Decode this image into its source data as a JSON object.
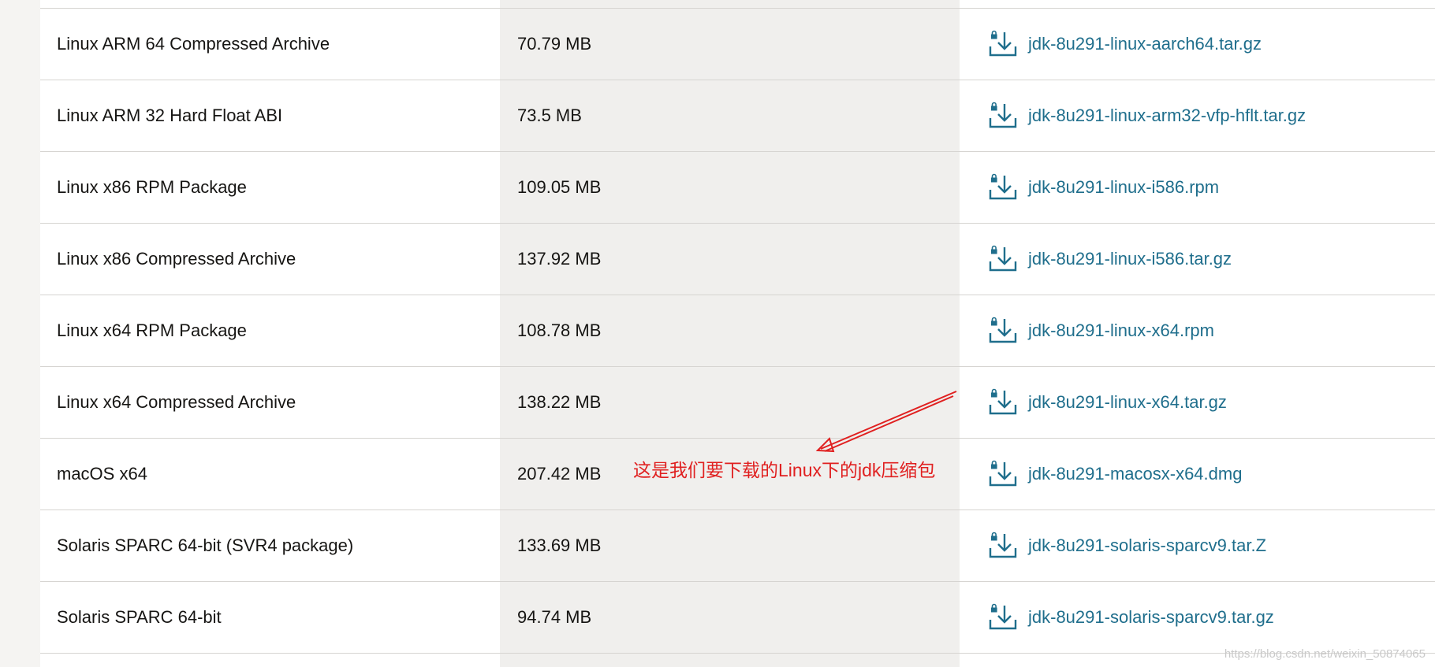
{
  "rows": [
    {
      "name": "Linux ARM 64 Compressed Archive",
      "size": "70.79 MB",
      "file": "jdk-8u291-linux-aarch64.tar.gz"
    },
    {
      "name": "Linux ARM 32 Hard Float ABI",
      "size": "73.5 MB",
      "file": "jdk-8u291-linux-arm32-vfp-hflt.tar.gz"
    },
    {
      "name": "Linux x86 RPM Package",
      "size": "109.05 MB",
      "file": "jdk-8u291-linux-i586.rpm"
    },
    {
      "name": "Linux x86 Compressed Archive",
      "size": "137.92 MB",
      "file": "jdk-8u291-linux-i586.tar.gz"
    },
    {
      "name": "Linux x64 RPM Package",
      "size": "108.78 MB",
      "file": "jdk-8u291-linux-x64.rpm"
    },
    {
      "name": "Linux x64 Compressed Archive",
      "size": "138.22 MB",
      "file": "jdk-8u291-linux-x64.tar.gz"
    },
    {
      "name": "macOS x64",
      "size": "207.42 MB",
      "file": "jdk-8u291-macosx-x64.dmg"
    },
    {
      "name": "Solaris SPARC 64-bit (SVR4 package)",
      "size": "133.69 MB",
      "file": "jdk-8u291-solaris-sparcv9.tar.Z"
    },
    {
      "name": "Solaris SPARC 64-bit",
      "size": "94.74 MB",
      "file": "jdk-8u291-solaris-sparcv9.tar.gz"
    }
  ],
  "download_icon": "download-lock-icon",
  "annotation": {
    "text": "这是我们要下载的Linux下的jdk压缩包",
    "color": "#e02020"
  },
  "watermark": "https://blog.csdn.net/weixin_50874065",
  "colors": {
    "link": "#1f6e8c",
    "shade": "#f0efed",
    "border": "#d6d4d1",
    "background": "#f5f4f2"
  }
}
